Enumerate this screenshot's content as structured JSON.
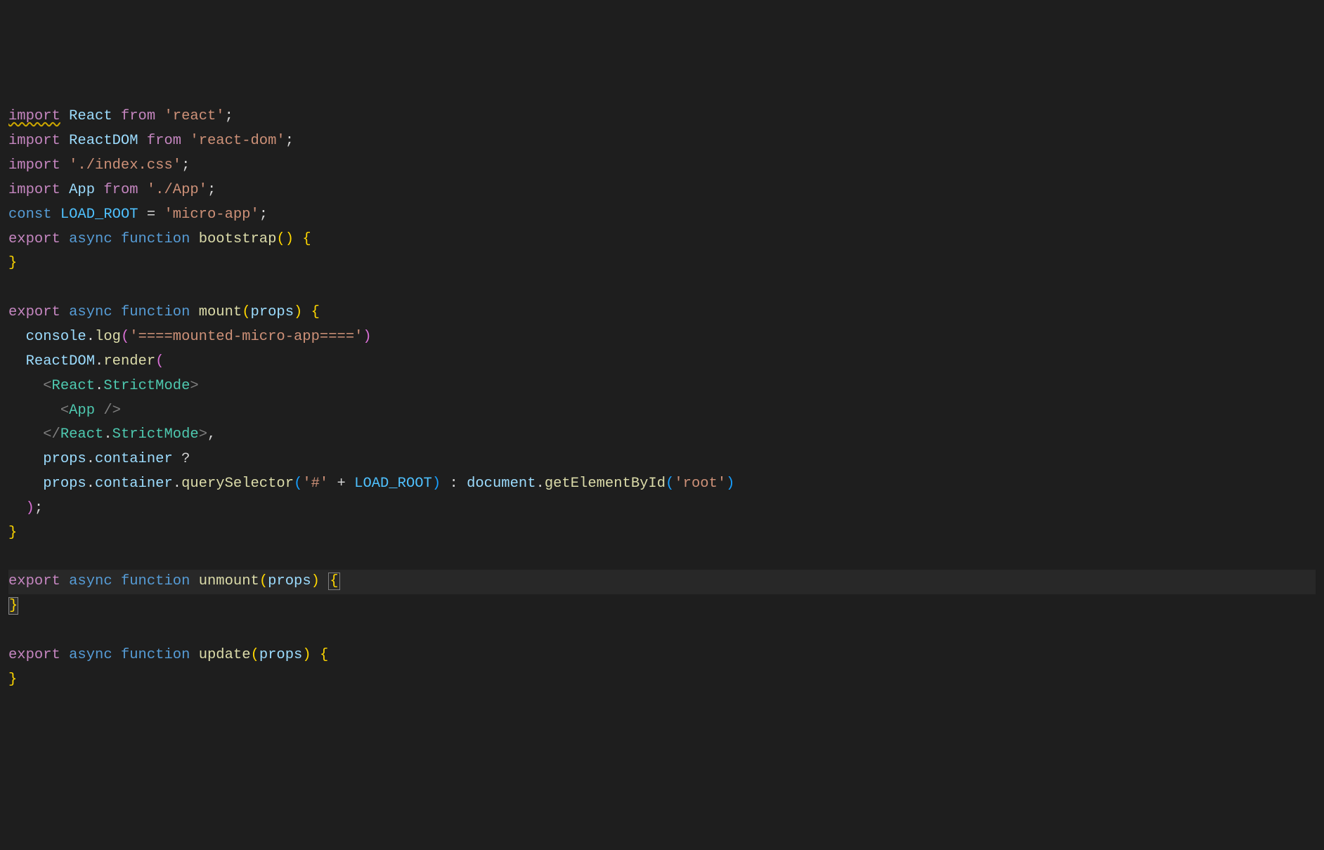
{
  "code": {
    "l1": {
      "import": "import",
      "react": "React",
      "from": "from",
      "str": "'react'",
      "semi": ";"
    },
    "l2": {
      "import": "import",
      "reactdom": "ReactDOM",
      "from": "from",
      "str": "'react-dom'",
      "semi": ";"
    },
    "l3": {
      "import": "import",
      "str": "'./index.css'",
      "semi": ";"
    },
    "l4": {
      "import": "import",
      "app": "App",
      "from": "from",
      "str": "'./App'",
      "semi": ";"
    },
    "l5": {
      "const": "const",
      "name": "LOAD_ROOT",
      "eq": " = ",
      "str": "'micro-app'",
      "semi": ";"
    },
    "l6": {
      "export": "export",
      "async": "async",
      "function": "function",
      "name": "bootstrap",
      "lp": "(",
      "rp": ")",
      "lb": " {"
    },
    "l7": {
      "rb": "}"
    },
    "l8": "",
    "l9": {
      "export": "export",
      "async": "async",
      "function": "function",
      "name": "mount",
      "lp": "(",
      "param": "props",
      "rp": ")",
      "lb": " {"
    },
    "l10": {
      "indent": "  ",
      "console": "console",
      "dot": ".",
      "log": "log",
      "lp": "(",
      "str": "'====mounted-micro-app===='",
      "rp": ")"
    },
    "l11": {
      "indent": "  ",
      "reactdom": "ReactDOM",
      "dot": ".",
      "render": "render",
      "lp": "("
    },
    "l12": {
      "indent": "    ",
      "lt": "<",
      "ns": "React",
      "dot": ".",
      "comp": "StrictMode",
      "gt": ">"
    },
    "l13": {
      "indent": "      ",
      "lt": "<",
      "comp": "App",
      "slash": " /",
      "gt": ">"
    },
    "l14": {
      "indent": "    ",
      "lt": "</",
      "ns": "React",
      "dot": ".",
      "comp": "StrictMode",
      "gt": ">",
      "comma": ","
    },
    "l15": {
      "indent": "    ",
      "props": "props",
      "dot": ".",
      "container": "container",
      "q": " ?"
    },
    "l16": {
      "indent": "    ",
      "props": "props",
      "dot1": ".",
      "container": "container",
      "dot2": ".",
      "qs": "querySelector",
      "lp": "(",
      "hash": "'#'",
      "plus": " + ",
      "root": "LOAD_ROOT",
      "rp": ")",
      "colon": " : ",
      "doc": "document",
      "dot3": ".",
      "gebi": "getElementById",
      "lp2": "(",
      "rootstr": "'root'",
      "rp2": ")"
    },
    "l17": {
      "indent": "  ",
      "rp": ")",
      "semi": ";"
    },
    "l18": {
      "rb": "}"
    },
    "l19": "",
    "l20": {
      "export": "export",
      "async": "async",
      "function": "function",
      "name": "unmount",
      "lp": "(",
      "param": "props",
      "rp": ")",
      "sp": " ",
      "lb": "{"
    },
    "l21": {
      "rb": "}"
    },
    "l22": "",
    "l23": {
      "export": "export",
      "async": "async",
      "function": "function",
      "name": "update",
      "lp": "(",
      "param": "props",
      "rp": ")",
      "lb": " {"
    },
    "l24": {
      "rb": "}"
    }
  }
}
